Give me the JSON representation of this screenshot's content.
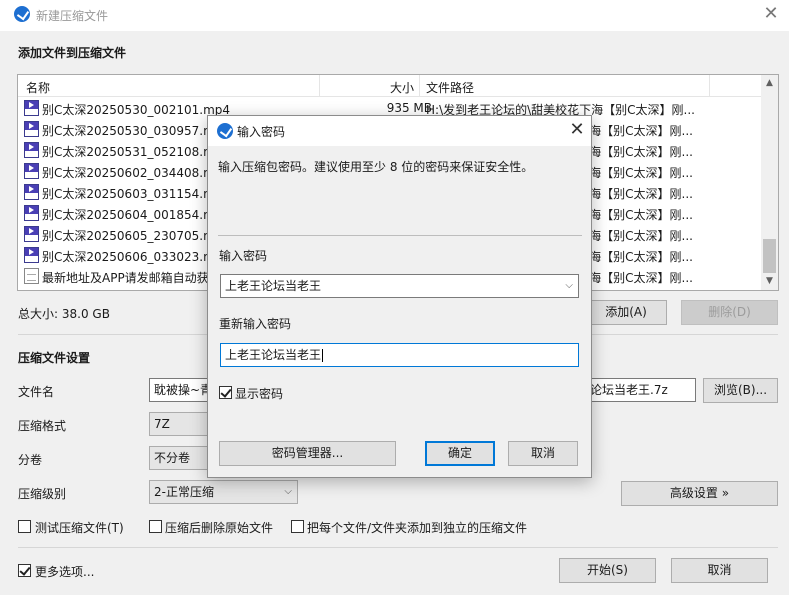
{
  "window": {
    "title": "新建压缩文件",
    "close": "✕"
  },
  "add_section": {
    "title": "添加文件到压缩文件"
  },
  "file_list": {
    "columns": {
      "name": "名称",
      "size": "大小",
      "path": "文件路径"
    },
    "rows": [
      {
        "icon": "mp4-file-icon",
        "name": "别C太深20250530_002101.mp4",
        "size": "935 MB",
        "path": "H:\\发到老王论坛的\\甜美校花下海【别C太深】刚..."
      },
      {
        "icon": "mp4-file-icon",
        "name": "别C太深20250530_030957.mp4",
        "size": "",
        "path": "海【别C太深】刚..."
      },
      {
        "icon": "mp4-file-icon",
        "name": "别C太深20250531_052108.mp4",
        "size": "",
        "path": "海【别C太深】刚..."
      },
      {
        "icon": "mp4-file-icon",
        "name": "别C太深20250602_034408.mp4",
        "size": "",
        "path": "海【别C太深】刚..."
      },
      {
        "icon": "mp4-file-icon",
        "name": "别C太深20250603_031154.mp4",
        "size": "",
        "path": "海【别C太深】刚..."
      },
      {
        "icon": "mp4-file-icon",
        "name": "别C太深20250604_001854.mp4",
        "size": "",
        "path": "海【别C太深】刚..."
      },
      {
        "icon": "mp4-file-icon",
        "name": "别C太深20250605_230705.mp4",
        "size": "",
        "path": "海【别C太深】刚..."
      },
      {
        "icon": "mp4-file-icon",
        "name": "别C太深20250606_033023.mp4",
        "size": "",
        "path": "海【别C太深】刚..."
      },
      {
        "icon": "text-file-icon",
        "name": "最新地址及APP请发邮箱自动获",
        "size": "",
        "path": "海【别C太深】刚..."
      }
    ]
  },
  "total_size": "总大小: 38.0 GB",
  "buttons": {
    "add": "添加(A)",
    "delete": "删除(D)",
    "browse": "浏览(B)...",
    "advanced": "高级设置 »",
    "start": "开始(S)",
    "cancel": "取消"
  },
  "settings": {
    "title": "压缩文件设置",
    "filename_label": "文件名",
    "filename_left": "耽被操~青春",
    "filename_right": "论坛当老王.7z",
    "format_label": "压缩格式",
    "format_value": "7Z",
    "split_label": "分卷",
    "split_value": "不分卷",
    "level_label": "压缩级别",
    "level_value": "2-正常压缩",
    "test_label": "测试压缩文件(T)",
    "delete_after_label": "压缩后删除原始文件",
    "separate_label": "把每个文件/文件夹添加到独立的压缩文件",
    "more_options_label": "更多选项..."
  },
  "dialog": {
    "title": "输入密码",
    "instruction": "输入压缩包密码。建议使用至少 8 位的密码来保证安全性。",
    "password_label": "输入密码",
    "password_value": "上老王论坛当老王",
    "reenter_label": "重新输入密码",
    "reenter_value": "上老王论坛当老王",
    "show_password_label": "显示密码",
    "show_password_checked": true,
    "manager_button": "密码管理器...",
    "ok_button": "确定",
    "cancel_button": "取消"
  },
  "colors": {
    "accent": "#0078d7",
    "app_icon": "#1d6fd1",
    "mp4_icon": "#4a3fb5"
  }
}
